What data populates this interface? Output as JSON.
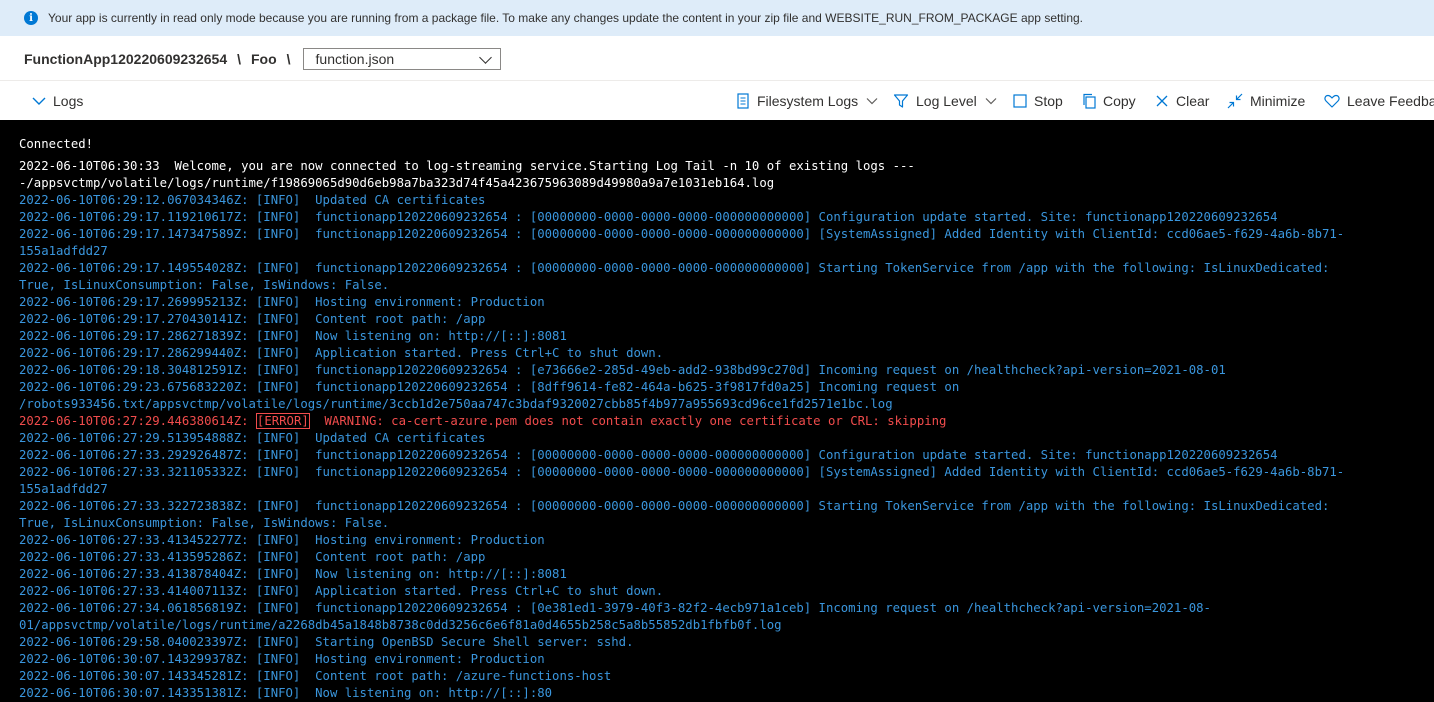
{
  "banner": {
    "icon": "info-icon",
    "text": "Your app is currently in read only mode because you are running from a package file. To make any changes update the content in your zip file and WEBSITE_RUN_FROM_PACKAGE app setting."
  },
  "breadcrumb": {
    "app": "FunctionApp120220609232654",
    "sep1": "\\",
    "function": "Foo",
    "sep2": "\\",
    "file_select": "function.json"
  },
  "toolbar": {
    "logs": "Logs",
    "filesystem_logs": "Filesystem Logs",
    "log_level": "Log Level",
    "stop": "Stop",
    "copy": "Copy",
    "clear": "Clear",
    "minimize": "Minimize",
    "leave_feedback": "Leave Feedback"
  },
  "console": {
    "connected": "Connected!",
    "welcome_1": "2022-06-10T06:30:33  Welcome, you are now connected to log-streaming service.Starting Log Tail -n 10 of existing logs ---",
    "welcome_2": "-/appsvctmp/volatile/logs/runtime/f19869065d90d6eb98a7ba323d74f45a423675963089d49980a9a7e1031eb164.log",
    "l01": "2022-06-10T06:29:12.067034346Z: [INFO]  Updated CA certificates",
    "l02": "2022-06-10T06:29:17.119210617Z: [INFO]  functionapp120220609232654 : [00000000-0000-0000-0000-000000000000] Configuration update started. Site: functionapp120220609232654",
    "l03a": "2022-06-10T06:29:17.147347589Z: [INFO]  functionapp120220609232654 : [00000000-0000-0000-0000-000000000000] [SystemAssigned] Added Identity with ClientId: ccd06ae5-f629-4a6b-8b71-",
    "l03b": "155a1adfdd27",
    "l04a": "2022-06-10T06:29:17.149554028Z: [INFO]  functionapp120220609232654 : [00000000-0000-0000-0000-000000000000] Starting TokenService from /app with the following: IsLinuxDedicated:",
    "l04b": "True, IsLinuxConsumption: False, IsWindows: False.",
    "l05": "2022-06-10T06:29:17.269995213Z: [INFO]  Hosting environment: Production",
    "l06": "2022-06-10T06:29:17.270430141Z: [INFO]  Content root path: /app",
    "l07": "2022-06-10T06:29:17.286271839Z: [INFO]  Now listening on: http://[::]:8081",
    "l08": "2022-06-10T06:29:17.286299440Z: [INFO]  Application started. Press Ctrl+C to shut down.",
    "l09": "2022-06-10T06:29:18.304812591Z: [INFO]  functionapp120220609232654 : [e73666e2-285d-49eb-add2-938bd99c270d] Incoming request on /healthcheck?api-version=2021-08-01",
    "l10a": "2022-06-10T06:29:23.675683220Z: [INFO]  functionapp120220609232654 : [8dff9614-fe82-464a-b625-3f9817fd0a25] Incoming request on",
    "l10b": "/robots933456.txt/appsvctmp/volatile/logs/runtime/3ccb1d2e750aa747c3bdaf9320027cbb85f4b977a955693cd96ce1fd2571e1bc.log",
    "err_ts": "2022-06-10T06:27:29.446380614Z: ",
    "err_tag": "[ERROR]",
    "err_msg": "  WARNING: ca-cert-azure.pem does not contain exactly one certificate or CRL: skipping",
    "l12": "2022-06-10T06:27:29.513954888Z: [INFO]  Updated CA certificates",
    "l13": "2022-06-10T06:27:33.292926487Z: [INFO]  functionapp120220609232654 : [00000000-0000-0000-0000-000000000000] Configuration update started. Site: functionapp120220609232654",
    "l14a": "2022-06-10T06:27:33.321105332Z: [INFO]  functionapp120220609232654 : [00000000-0000-0000-0000-000000000000] [SystemAssigned] Added Identity with ClientId: ccd06ae5-f629-4a6b-8b71-",
    "l14b": "155a1adfdd27",
    "l15a": "2022-06-10T06:27:33.322723838Z: [INFO]  functionapp120220609232654 : [00000000-0000-0000-0000-000000000000] Starting TokenService from /app with the following: IsLinuxDedicated:",
    "l15b": "True, IsLinuxConsumption: False, IsWindows: False.",
    "l16": "2022-06-10T06:27:33.413452277Z: [INFO]  Hosting environment: Production",
    "l17": "2022-06-10T06:27:33.413595286Z: [INFO]  Content root path: /app",
    "l18": "2022-06-10T06:27:33.413878404Z: [INFO]  Now listening on: http://[::]:8081",
    "l19": "2022-06-10T06:27:33.414007113Z: [INFO]  Application started. Press Ctrl+C to shut down.",
    "l20a": "2022-06-10T06:27:34.061856819Z: [INFO]  functionapp120220609232654 : [0e381ed1-3979-40f3-82f2-4ecb971a1ceb] Incoming request on /healthcheck?api-version=2021-08-",
    "l20b": "01/appsvctmp/volatile/logs/runtime/a2268db45a1848b8738c0dd3256c6e6f81a0d4655b258c5a8b55852db1fbfb0f.log",
    "l21": "2022-06-10T06:29:58.040023397Z: [INFO]  Starting OpenBSD Secure Shell server: sshd.",
    "l22": "2022-06-10T06:30:07.143299378Z: [INFO]  Hosting environment: Production",
    "l23": "2022-06-10T06:30:07.143345281Z: [INFO]  Content root path: /azure-functions-host",
    "l24": "2022-06-10T06:30:07.143351381Z: [INFO]  Now listening on: http://[::]:80"
  },
  "colors": {
    "banner_bg": "#deecf9",
    "accent": "#0078d4",
    "console_bg": "#000000",
    "info_text": "#3a96dd",
    "error_text": "#f14c4c"
  }
}
